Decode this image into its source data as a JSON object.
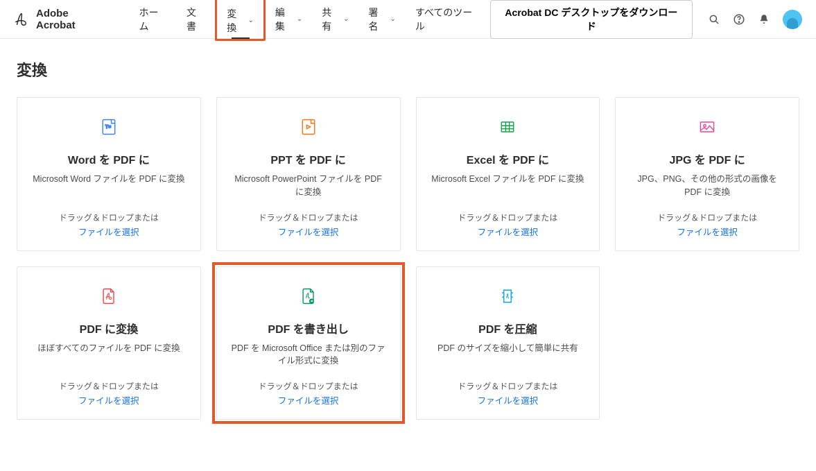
{
  "brand": {
    "name": "Adobe Acrobat"
  },
  "nav": {
    "items": [
      {
        "label": "ホーム",
        "dropdown": false
      },
      {
        "label": "文書",
        "dropdown": false
      },
      {
        "label": "変換",
        "dropdown": true,
        "active": true
      },
      {
        "label": "編集",
        "dropdown": true
      },
      {
        "label": "共有",
        "dropdown": true
      },
      {
        "label": "署名",
        "dropdown": true
      },
      {
        "label": "すべてのツール",
        "dropdown": false
      }
    ]
  },
  "download_button": "Acrobat DC デスクトップをダウンロード",
  "page_title": "変換",
  "common": {
    "drag_text": "ドラッグ＆ドロップまたは",
    "select_link": "ファイルを選択"
  },
  "cards": [
    {
      "title": "Word を PDF に",
      "desc": "Microsoft Word ファイルを PDF に変換"
    },
    {
      "title": "PPT を PDF に",
      "desc": "Microsoft PowerPoint ファイルを PDF に変換"
    },
    {
      "title": "Excel を PDF に",
      "desc": "Microsoft Excel ファイルを PDF に変換"
    },
    {
      "title": "JPG を PDF に",
      "desc": "JPG、PNG、その他の形式の画像を PDF に変換"
    },
    {
      "title": "PDF に変換",
      "desc": "ほぼすべてのファイルを PDF に変換"
    },
    {
      "title": "PDF を書き出し",
      "desc": "PDF を Microsoft Office または別のファイル形式に変換"
    },
    {
      "title": "PDF を圧縮",
      "desc": "PDF のサイズを縮小して簡単に共有"
    }
  ],
  "icon_colors": {
    "word": "#3b82f6",
    "ppt": "#f97316",
    "excel": "#16a34a",
    "jpg": "#ec4899",
    "pdf": "#ef4444",
    "export": "#059669",
    "compress": "#0ea5e9"
  }
}
